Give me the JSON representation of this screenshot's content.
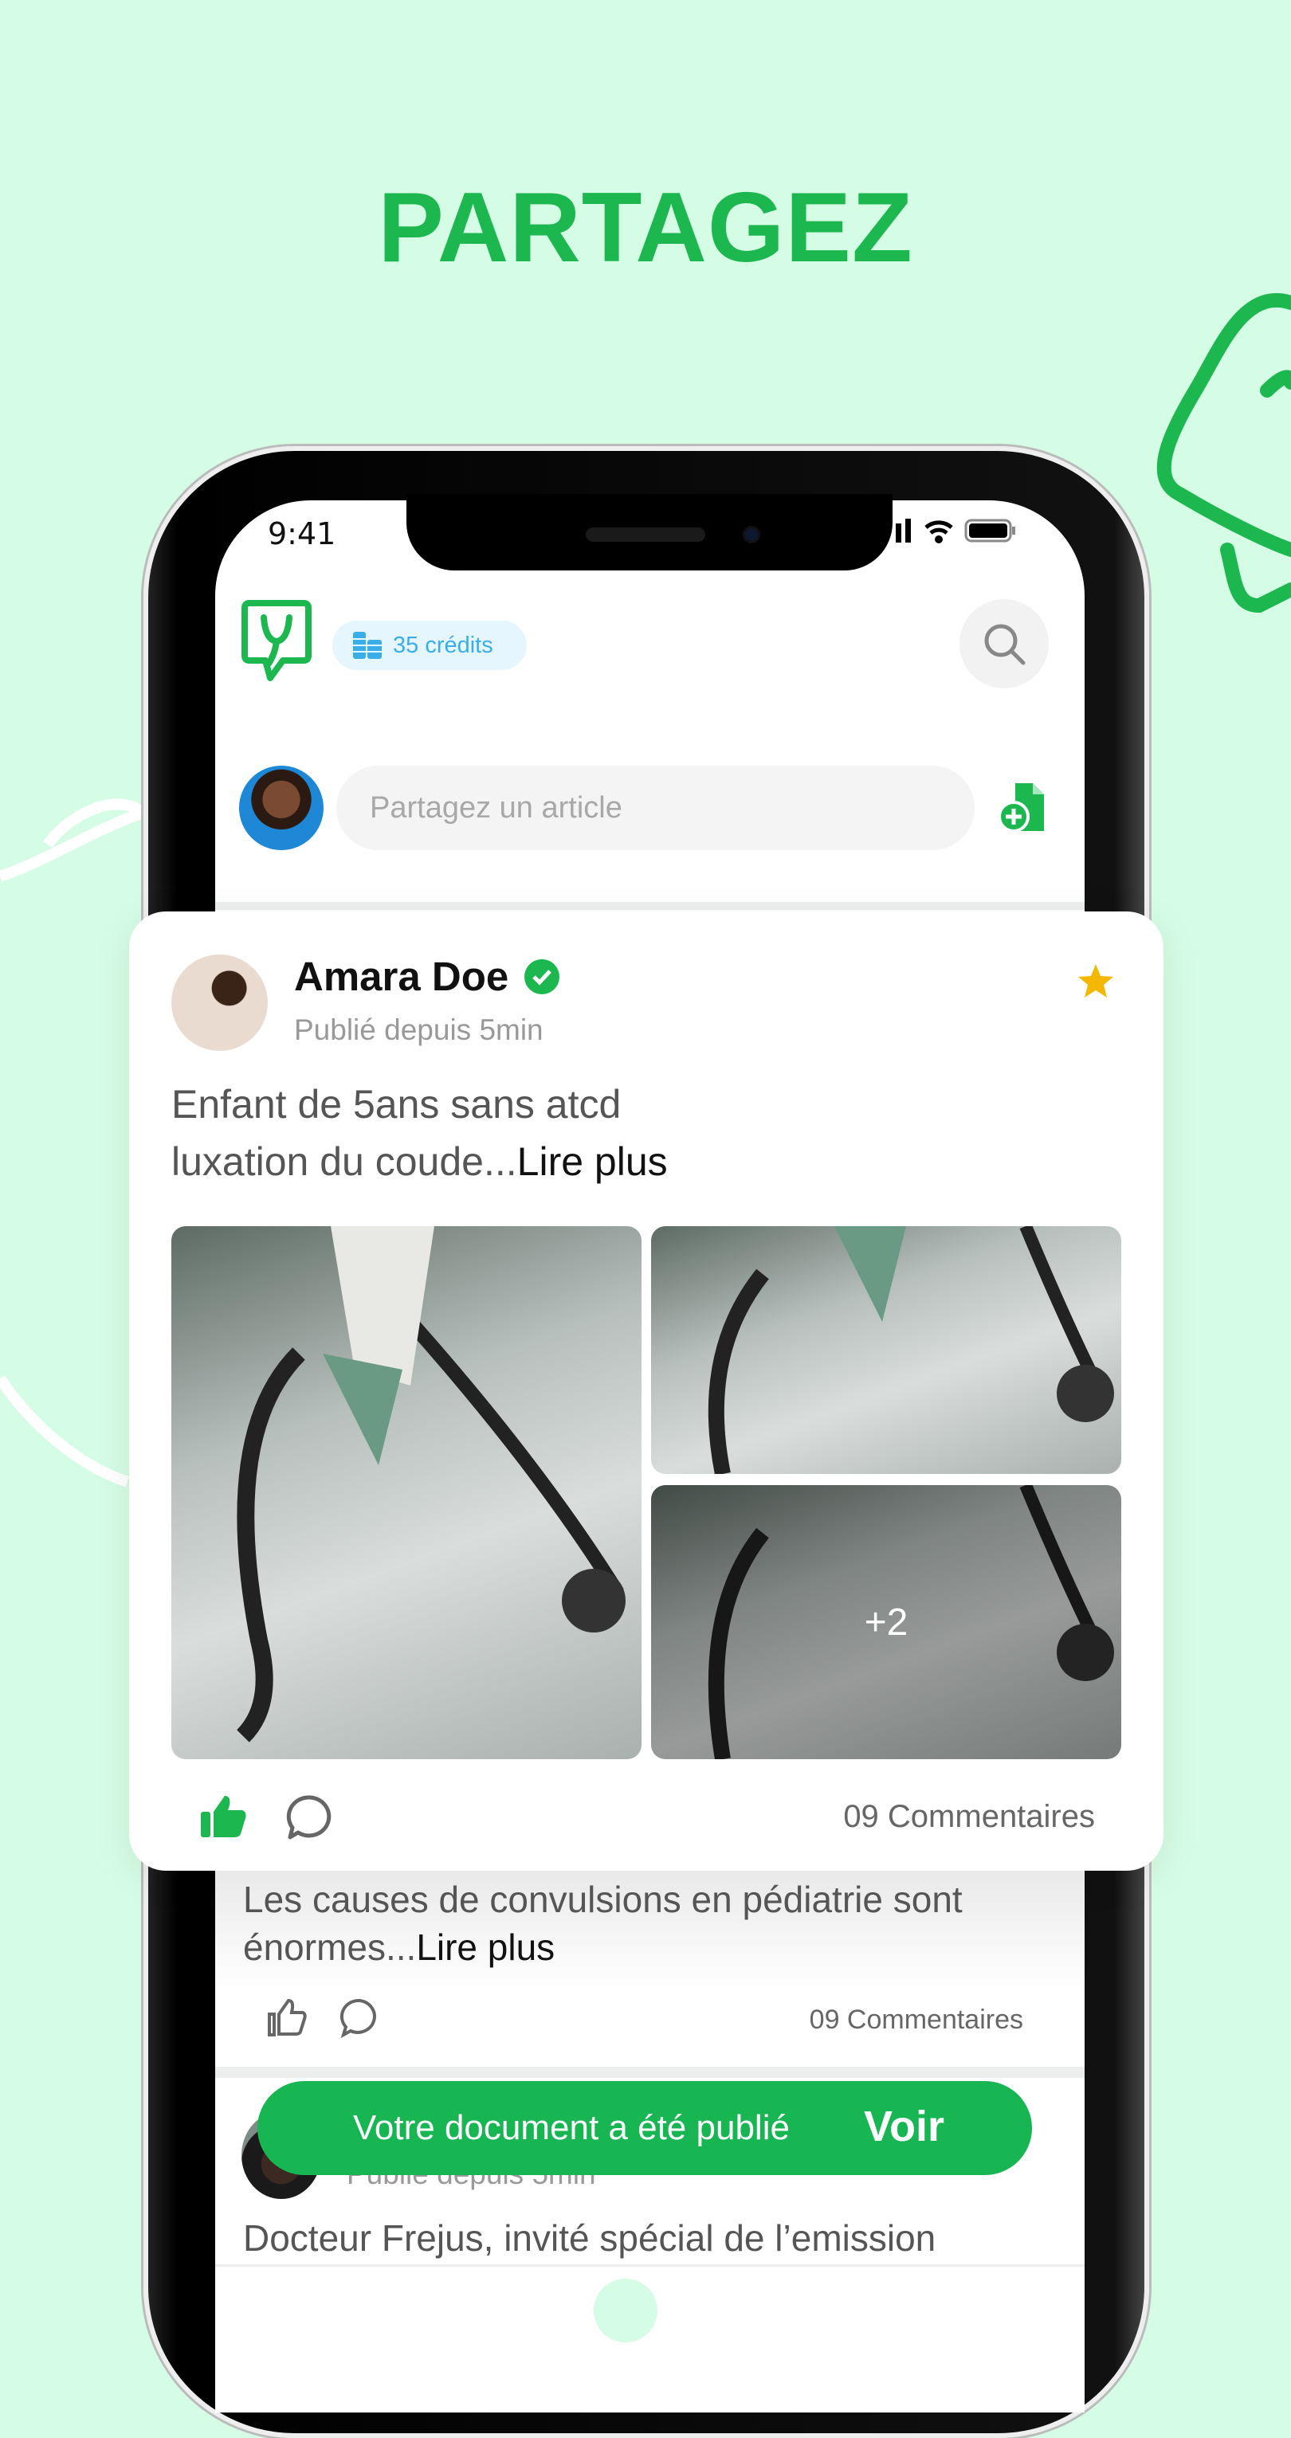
{
  "headline": "PARTAGEZ",
  "status_bar": {
    "time": "9:41"
  },
  "header": {
    "credits_label": "35 crédits",
    "logo": "stethoscope-chat-logo",
    "search_icon": "search-icon"
  },
  "composer": {
    "placeholder": "Partagez un article",
    "attach_icon": "add-document-icon"
  },
  "featured_post": {
    "author": "Amara Doe",
    "verified": true,
    "published": "Publié depuis 5min",
    "text": "Enfant de 5ans sans atcd luxation du coude...",
    "text_line1": "Enfant de 5ans sans atcd",
    "text_line2": "luxation du coude...",
    "read_more": "Lire plus",
    "extra_images": "+2",
    "comments": "09 Commentaires",
    "liked": true,
    "favorite": true
  },
  "post2": {
    "text_line1": "Les causes de convulsions en pédiatrie sont",
    "text_line2": "énormes...",
    "read_more": "Lire plus",
    "comments": "09 Commentaires"
  },
  "post3": {
    "published": "Publié depuis 5min",
    "text": "Docteur Frejus, invité spécial de l’emission"
  },
  "toast": {
    "message": "Votre document a été publié",
    "action": "Voir"
  },
  "colors": {
    "brand": "#1cb84f",
    "background": "#d5fce4",
    "credits": "#3aaee8",
    "star": "#f5b800"
  }
}
